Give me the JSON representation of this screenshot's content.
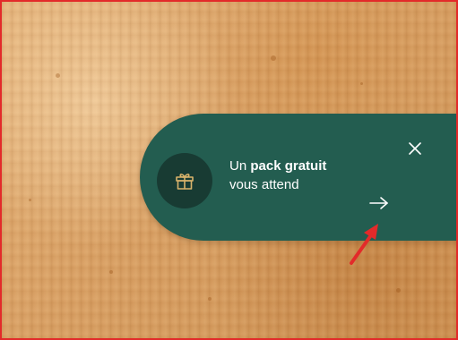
{
  "promo": {
    "line1_prefix": "Un",
    "line1_bold": "pack gratuit",
    "line2": "vous attend",
    "icon": "gift-icon",
    "close_icon": "close-icon",
    "arrow_icon": "arrow-right-icon"
  },
  "colors": {
    "banner": "#235d50",
    "badge": "#183b33",
    "icon_gold": "#d9b36b",
    "annotation_red": "#e32a2a",
    "frame_border": "#e32a2a"
  }
}
